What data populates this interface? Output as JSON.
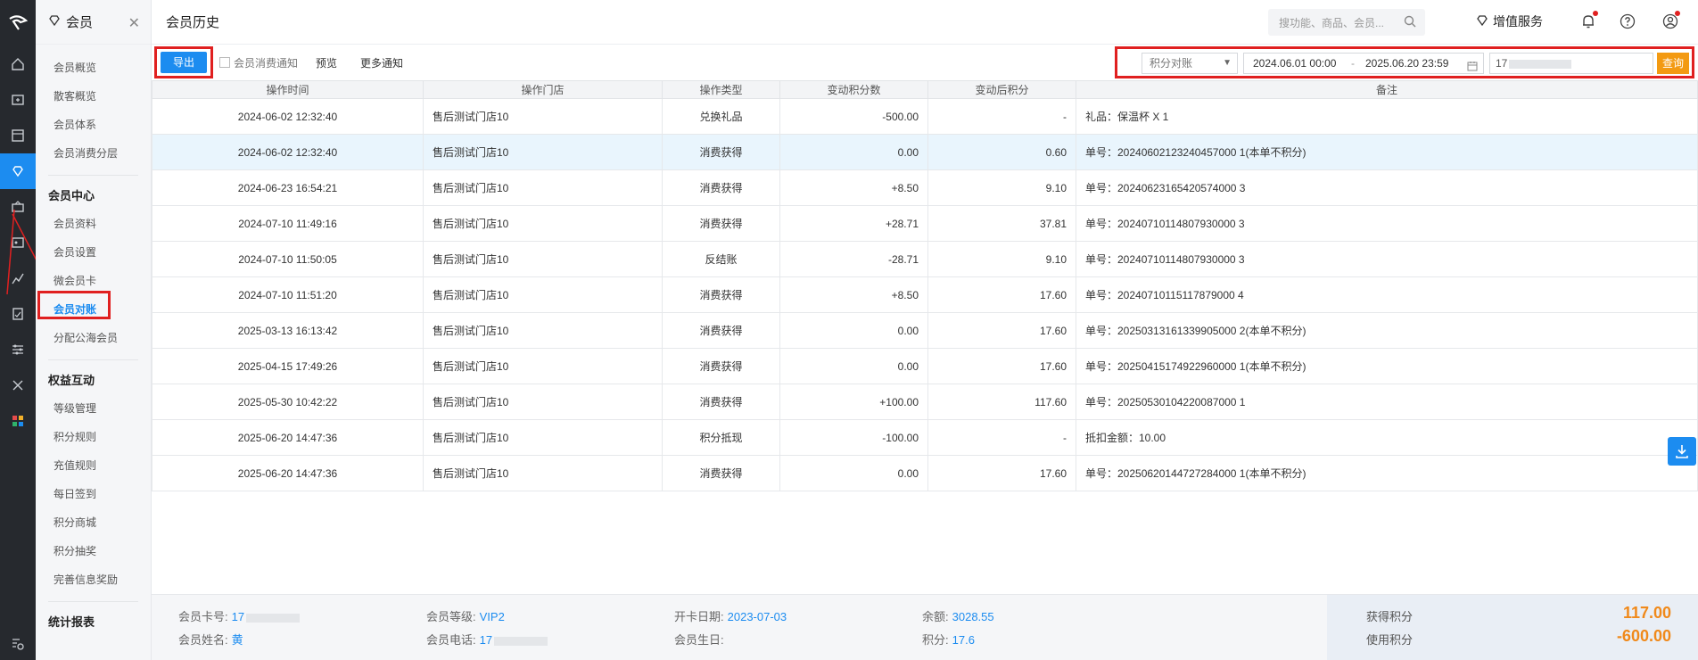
{
  "module": {
    "title": "会员"
  },
  "sidebar": {
    "items_top": [
      "会员概览",
      "散客概览",
      "会员体系",
      "会员消费分层"
    ],
    "group_center": "会员中心",
    "items_center": [
      "会员资料",
      "会员设置",
      "微会员卡",
      "会员对账",
      "分配公海会员"
    ],
    "group_interact": "权益互动",
    "items_interact": [
      "等级管理",
      "积分规则",
      "充值规则",
      "每日签到",
      "积分商城",
      "积分抽奖",
      "完善信息奖励"
    ],
    "group_report": "统计报表"
  },
  "topbar": {
    "page_title": "会员历史",
    "search_placeholder": "搜功能、商品、会员...",
    "value_added": "增值服务"
  },
  "toolbar": {
    "export": "导出",
    "notify": "会员消费通知",
    "preview": "预览",
    "more": "更多通知",
    "select_value": "积分对账",
    "date_start": "2024.06.01 00:00",
    "date_sep": "-",
    "date_end": "2025.06.20 23:59",
    "card_value": "17",
    "query": "查询"
  },
  "table": {
    "headers": [
      "操作时间",
      "操作门店",
      "操作类型",
      "变动积分数",
      "变动后积分",
      "备注"
    ],
    "rows": [
      [
        "2024-06-02 12:32:40",
        "售后测试门店10",
        "兑换礼品",
        "-500.00",
        "-",
        "礼品：保温杯 X 1"
      ],
      [
        "2024-06-02 12:32:40",
        "售后测试门店10",
        "消费获得",
        "0.00",
        "0.60",
        "单号：20240602123240457000 1(本单不积分)"
      ],
      [
        "2024-06-23 16:54:21",
        "售后测试门店10",
        "消费获得",
        "+8.50",
        "9.10",
        "单号：20240623165420574000 3"
      ],
      [
        "2024-07-10 11:49:16",
        "售后测试门店10",
        "消费获得",
        "+28.71",
        "37.81",
        "单号：20240710114807930000 3"
      ],
      [
        "2024-07-10 11:50:05",
        "售后测试门店10",
        "反结账",
        "-28.71",
        "9.10",
        "单号：20240710114807930000 3"
      ],
      [
        "2024-07-10 11:51:20",
        "售后测试门店10",
        "消费获得",
        "+8.50",
        "17.60",
        "单号：20240710115117879000 4"
      ],
      [
        "2025-03-13 16:13:42",
        "售后测试门店10",
        "消费获得",
        "0.00",
        "17.60",
        "单号：20250313161339905000 2(本单不积分)"
      ],
      [
        "2025-04-15 17:49:26",
        "售后测试门店10",
        "消费获得",
        "0.00",
        "17.60",
        "单号：20250415174922960000 1(本单不积分)"
      ],
      [
        "2025-05-30 10:42:22",
        "售后测试门店10",
        "消费获得",
        "+100.00",
        "117.60",
        "单号：20250530104220087000 1"
      ],
      [
        "2025-06-20 14:47:36",
        "售后测试门店10",
        "积分抵现",
        "-100.00",
        "-",
        "抵扣金额：10.00"
      ],
      [
        "2025-06-20 14:47:36",
        "售后测试门店10",
        "消费获得",
        "0.00",
        "17.60",
        "单号：20250620144727284000 1(本单不积分)"
      ]
    ]
  },
  "footer": {
    "card_no_label": "会员卡号:",
    "card_no": "17",
    "name_label": "会员姓名:",
    "name": "黄",
    "level_label": "会员等级:",
    "level": "VIP2",
    "phone_label": "会员电话:",
    "phone": "17",
    "open_date_label": "开卡日期:",
    "open_date": "2023-07-03",
    "birthday_label": "会员生日:",
    "birthday": "",
    "balance_label": "余额:",
    "balance": "3028.55",
    "points_label": "积分:",
    "points": "17.6",
    "earned_label": "获得积分",
    "earned": "117.00",
    "used_label": "使用积分",
    "used": "-600.00"
  },
  "colors": {
    "accent": "#1c8cf0",
    "query": "#f39a12",
    "highlight": "#e02020",
    "points": "#f0891a"
  }
}
